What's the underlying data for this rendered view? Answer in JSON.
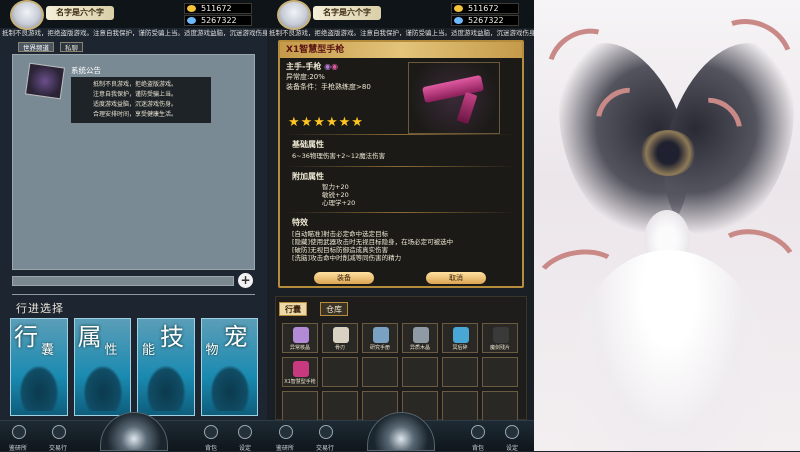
{
  "left_screen": {
    "player_name": "名字是六个字",
    "gold": "511672",
    "gems": "5267322",
    "marquee": "抵制不良游戏，拒绝盗版游戏。注意自我保护，谨防受骗上当。适度游戏益脑，沉迷游戏伤身。合理安",
    "tabs": [
      "世界频道",
      "私聊"
    ],
    "system_title": "系统公告",
    "notice_lines": [
      "抵制不良游戏，拒绝盗版游戏。",
      "注意自我保护，谨防受骗上当。",
      "适度游戏益脑，沉迷游戏伤身。",
      "合理安排时间，享受健康生活。"
    ],
    "plus": "+",
    "section_title": "行进选择",
    "cards": [
      {
        "big": "行",
        "small": "囊"
      },
      {
        "big": "属",
        "small": "性"
      },
      {
        "big": "技",
        "small": "能"
      },
      {
        "big": "宠",
        "small": "物"
      }
    ],
    "bottom_nav": [
      "鉴研所",
      "交易行",
      "背包",
      "设定"
    ]
  },
  "middle_screen": {
    "player_name": "名字是六个字",
    "gold": "511672",
    "gems": "5267322",
    "marquee": "抵制不良游戏，拒绝盗版游戏。注意自我保护，谨防受骗上当。适度游戏益脑，沉迷游戏伤身。合理安排时",
    "item_title": "X1智慧型手枪",
    "slot_label": "主手-手枪",
    "rarity_text": "异常度:20%",
    "requirement": "装备条件：手枪熟练度>80",
    "stars": "★★★★★★",
    "base_title": "基础属性",
    "base_text": "6~36物理伤害+2~12魔法伤害",
    "extra_title": "附加属性",
    "extra_lines": [
      "智力+20",
      "敏锐+20",
      "心理学+20"
    ],
    "special_title": "特效",
    "special_lines": [
      "[自动瞄准]射击必定命中选定目标",
      "[隐藏]使用武器攻击时无视目标隐身，在场必定可被选中",
      "[破防]无视目标防御造成真实伤害",
      "[洗脑]攻击命中时削减等同伤害的精力"
    ],
    "equip_button": "装备",
    "cancel_button": "取消",
    "bag_tabs": [
      "行囊",
      "仓库"
    ],
    "bag_items": [
      {
        "name": "异常核晶",
        "color": "#b28ad6"
      },
      {
        "name": "骨刃",
        "color": "#d9d2c2"
      },
      {
        "name": "研究手册",
        "color": "#7aa1c2"
      },
      {
        "name": "异质木晶",
        "color": "#8e9aa4"
      },
      {
        "name": "冥后碎",
        "color": "#49a7d6"
      },
      {
        "name": "魔剑残片",
        "color": "#3a3a3a"
      },
      {
        "name": "X1智慧型手枪",
        "color": "#c8397f"
      }
    ],
    "bottom_nav": [
      "鉴研所",
      "交易行",
      "背包",
      "设定"
    ]
  }
}
